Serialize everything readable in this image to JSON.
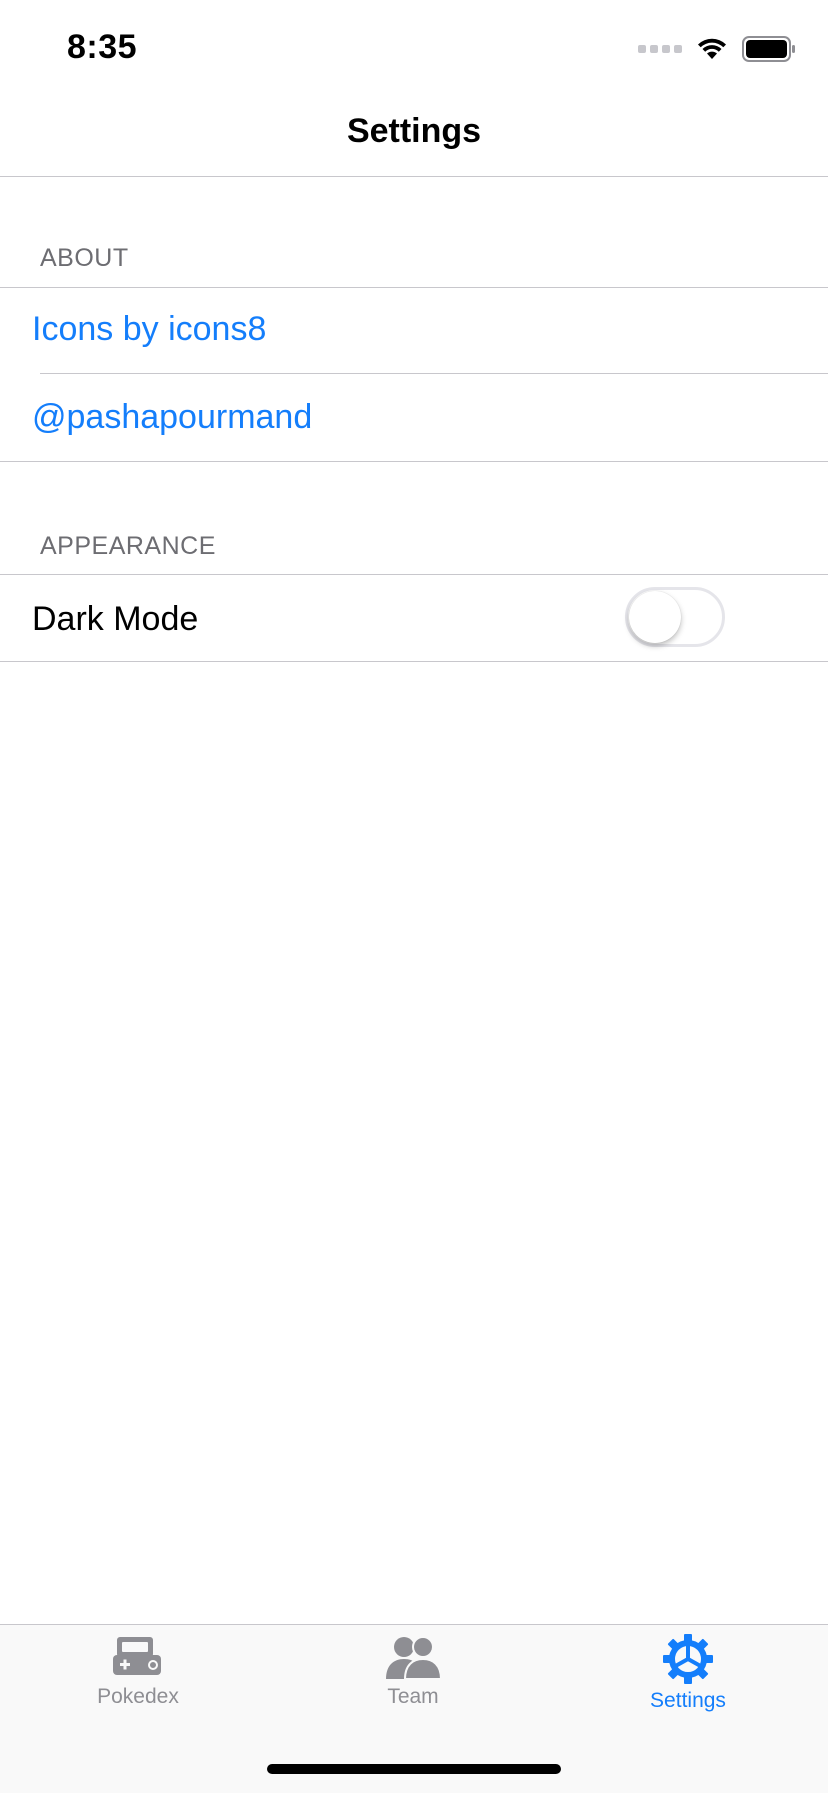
{
  "status_bar": {
    "time": "8:35"
  },
  "nav": {
    "title": "Settings"
  },
  "sections": {
    "about": {
      "header": "ABOUT",
      "items": [
        {
          "label": "Icons by icons8"
        },
        {
          "label": "@pashapourmand"
        }
      ]
    },
    "appearance": {
      "header": "APPEARANCE",
      "items": [
        {
          "label": "Dark Mode",
          "toggle_on": false
        }
      ]
    }
  },
  "tab_bar": {
    "items": [
      {
        "label": "Pokedex",
        "icon": "pokedex-icon",
        "selected": false
      },
      {
        "label": "Team",
        "icon": "team-icon",
        "selected": false
      },
      {
        "label": "Settings",
        "icon": "gear-icon",
        "selected": true
      }
    ]
  },
  "colors": {
    "accent": "#147efb",
    "inactive_tab": "#8e8e93",
    "separator": "#c8c7cc",
    "section_header": "#6d6d72"
  }
}
